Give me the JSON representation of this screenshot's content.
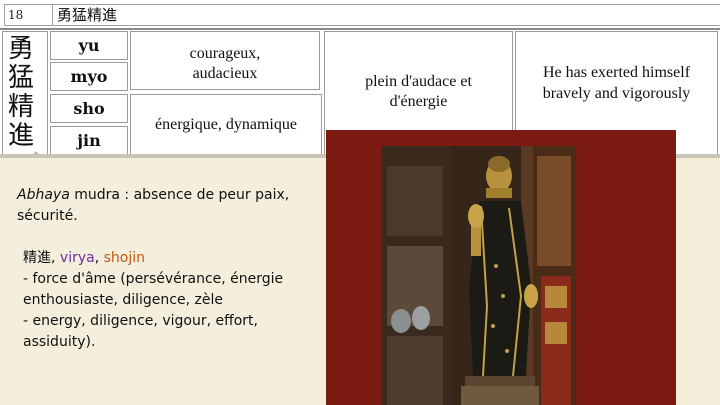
{
  "header": {
    "number": "18",
    "word": "勇猛精進"
  },
  "kanji": [
    "勇",
    "猛",
    "精",
    "進"
  ],
  "readings": [
    "yu",
    "myo",
    "sho",
    "jin"
  ],
  "table": {
    "fr_yumyo": "courageux, audacieux",
    "fr_shojin": "énergique, dynamique",
    "fr_compound": "plein d'audace et d'énergie",
    "en_compound": "He has exerted himself bravely and vigorously"
  },
  "caption": {
    "abhaya_word": "Abhaya",
    "abhaya_rest": " mudra : absence de peur paix, sécurité.",
    "kanji_term": "精進",
    "sep1": ", ",
    "virya": "virya",
    "sep2": ", ",
    "shojin": "shojin",
    "line_fr": "- force d'âme (persévérance, énergie enthousiaste, diligence, zèle",
    "line_en": "- energy, diligence, vigour, effort, assiduity)."
  },
  "colors": {
    "virya": "#7030a0",
    "shojin": "#c55a11",
    "frame": "#7a1a10"
  }
}
